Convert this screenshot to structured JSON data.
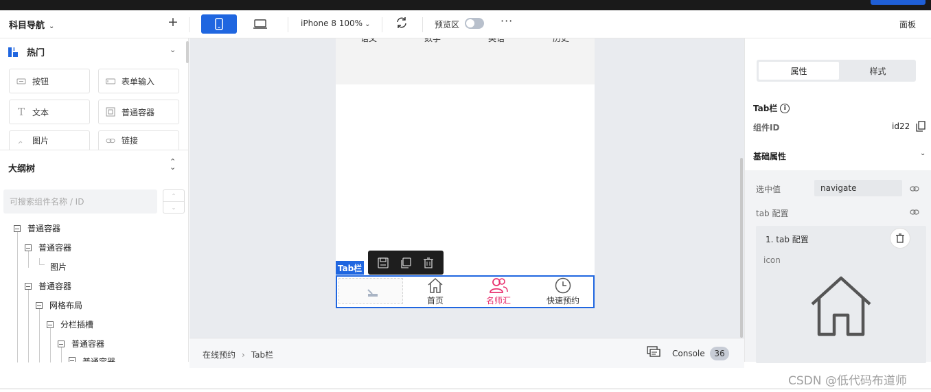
{
  "toolbar": {
    "nav_title": "科目导航",
    "device": "iPhone 8 100%",
    "preview_label": "预览区",
    "panel_label": "面板",
    "preview_on": false
  },
  "left_panel": {
    "hot_title": "热门",
    "components": [
      {
        "label": "按钮",
        "icon": "button-icon"
      },
      {
        "label": "表单输入",
        "icon": "input-icon"
      },
      {
        "label": "文本",
        "icon": "text-icon"
      },
      {
        "label": "普通容器",
        "icon": "container-icon"
      },
      {
        "label": "图片",
        "icon": "image-icon"
      },
      {
        "label": "链接",
        "icon": "link-icon"
      }
    ],
    "outline_title": "大纲树",
    "search_placeholder": "可搜索组件名称 / ID",
    "tree": [
      {
        "label": "普通容器",
        "level": 0,
        "expanded": true
      },
      {
        "label": "普通容器",
        "level": 1,
        "expanded": true
      },
      {
        "label": "图片",
        "level": 2,
        "leaf": true
      },
      {
        "label": "普通容器",
        "level": 1,
        "expanded": true
      },
      {
        "label": "网格布局",
        "level": 2,
        "expanded": true
      },
      {
        "label": "分栏插槽",
        "level": 3,
        "expanded": true
      },
      {
        "label": "普通容器",
        "level": 4,
        "expanded": true
      },
      {
        "label": "普通容器",
        "level": 5,
        "expanded": true
      }
    ]
  },
  "canvas": {
    "subject_tabs": [
      "语文",
      "数学",
      "英语",
      "历史"
    ],
    "tabbar_label": "Tab栏",
    "tabbar_items": [
      {
        "label": "",
        "icon": "placeholder-icon",
        "active": false
      },
      {
        "label": "首页",
        "icon": "home-icon",
        "active": false
      },
      {
        "label": "名师汇",
        "icon": "users-icon",
        "active": true
      },
      {
        "label": "快速预约",
        "icon": "clock-icon",
        "active": false
      }
    ],
    "accent_color": "#1f66e0",
    "active_color": "#e8306e"
  },
  "bottombar": {
    "breadcrumb": [
      "在线预约",
      "Tab栏"
    ],
    "console_label": "Console",
    "console_count": "36"
  },
  "right_panel": {
    "tab_props": "属性",
    "tab_style": "样式",
    "component_name": "Tab栏",
    "id_label": "组件ID",
    "id_value": "id22",
    "basic_title": "基础属性",
    "selected_label": "选中值",
    "selected_value": "navigate",
    "tab_config_label": "tab 配置",
    "card_title": "1. tab 配置",
    "icon_label": "icon"
  },
  "watermark": "CSDN @低代码布道师"
}
